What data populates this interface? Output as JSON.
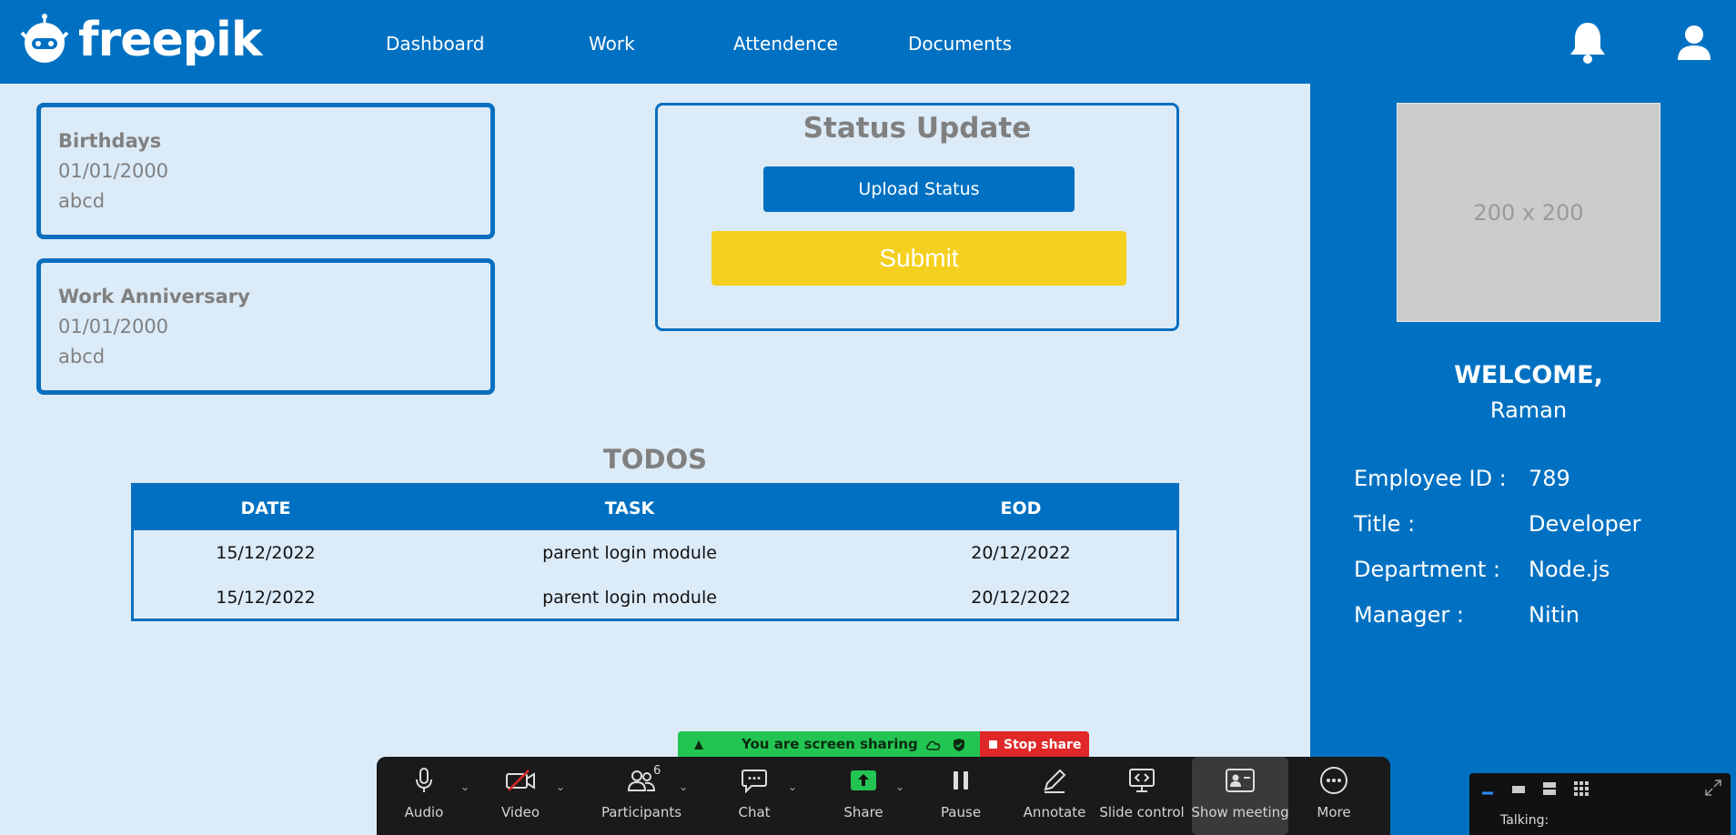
{
  "header": {
    "brand": "freepik",
    "nav": [
      "Dashboard",
      "Work",
      "Attendence",
      "Documents"
    ]
  },
  "cards": {
    "birthdays": {
      "title": "Birthdays",
      "date": "01/01/2000",
      "name": "abcd"
    },
    "anniversary": {
      "title": "Work Anniversary",
      "date": "01/01/2000",
      "name": "abcd"
    }
  },
  "status": {
    "title": "Status Update",
    "upload_label": "Upload Status",
    "submit_label": "Submit"
  },
  "todos": {
    "title": "TODOS",
    "columns": [
      "DATE",
      "TASK",
      "EOD"
    ],
    "rows": [
      [
        "15/12/2022",
        "parent login module",
        "20/12/2022"
      ],
      [
        "15/12/2022",
        "parent login module",
        "20/12/2022"
      ]
    ]
  },
  "profile": {
    "photo_placeholder": "200 x 200",
    "welcome": "WELCOME,",
    "name": "Raman",
    "fields": [
      {
        "label": "Employee ID :",
        "value": "789"
      },
      {
        "label": "Title :",
        "value": "Developer"
      },
      {
        "label": "Department :",
        "value": "Node.js"
      },
      {
        "label": "Manager :",
        "value": "Nitin"
      }
    ]
  },
  "share": {
    "banner": "You are screen sharing",
    "stop": "Stop share"
  },
  "toolbar": {
    "items": [
      "Audio",
      "Video",
      "Participants",
      "Chat",
      "Share",
      "Pause",
      "Annotate",
      "Slide control",
      "Show meeting",
      "More"
    ],
    "participants_count": "6"
  },
  "mini_panel": {
    "talking": "Talking:"
  },
  "colors": {
    "brand_blue": "#0071c2",
    "page_bg": "#dcebf8",
    "submit_yellow": "#f5d01e",
    "share_green": "#23c552",
    "stop_red": "#e02828"
  }
}
